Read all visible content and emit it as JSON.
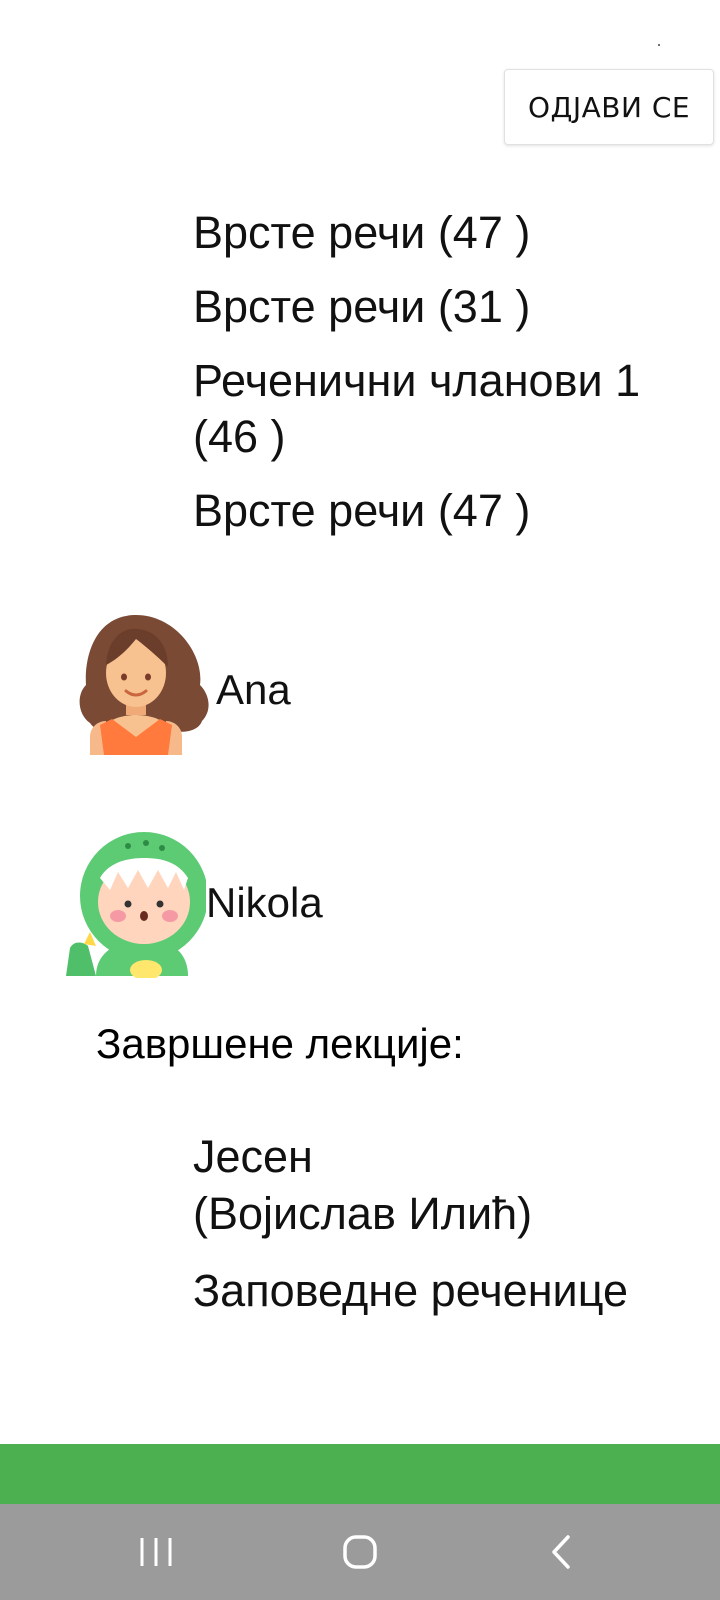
{
  "header": {
    "logout_label": "ОДЈАВИ СЕ"
  },
  "lessons": [
    {
      "label": "Врсте речи (47 )"
    },
    {
      "label": "Врсте речи (31 )"
    },
    {
      "label": "Реченични чланови 1 (46 )"
    },
    {
      "label": "Врсте речи (47 )"
    }
  ],
  "students": [
    {
      "name": "Ana",
      "avatar_icon": "girl-avatar-icon"
    },
    {
      "name": "Nikola",
      "avatar_icon": "dino-costume-avatar-icon"
    }
  ],
  "completed": {
    "title": "Завршене лекције:",
    "items": [
      {
        "label": "Јесен\n (Војислав Илић)"
      },
      {
        "label": "Заповедне реченице"
      }
    ]
  },
  "colors": {
    "accent_bar": "#4caf50",
    "nav_bar": "#9b9b9b"
  },
  "system_nav": {
    "icons": [
      "recents-icon",
      "home-icon",
      "back-icon"
    ]
  }
}
